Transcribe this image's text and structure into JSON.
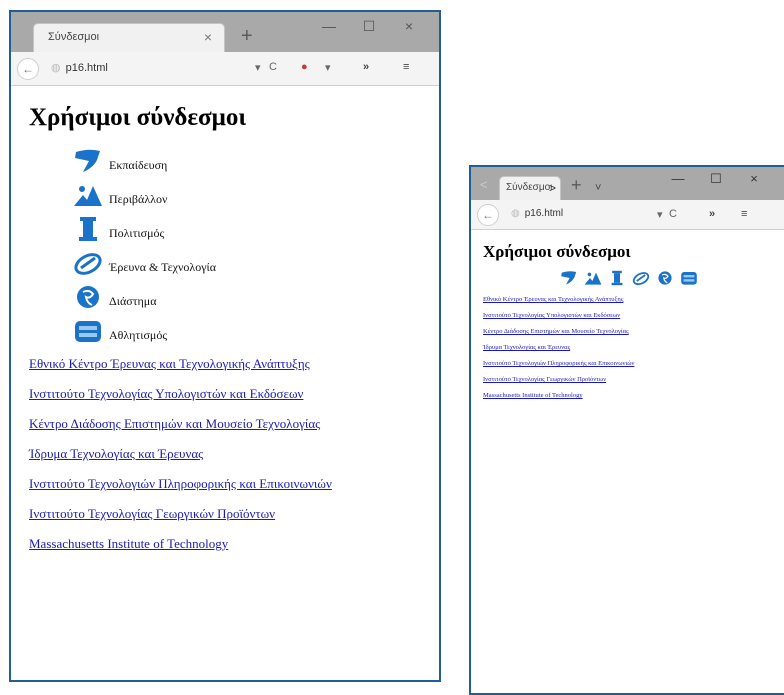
{
  "browser": {
    "tab_title": "Σύνδεσμοι",
    "url": "p16.html",
    "tab_close": "×",
    "new_tab": "+",
    "tab_list_arrow": ">",
    "tab_list_more": "˅",
    "back": "←",
    "reload": "C",
    "dropdown": "▾",
    "overflow": "»",
    "menu": "≡",
    "back_faint": "<",
    "win_min": "—",
    "win_max": "☐",
    "win_close": "×"
  },
  "page": {
    "heading": "Χρήσιμοι σύνδεσμοι",
    "categories": [
      {
        "label": "Εκπαίδευση",
        "icon": "education-icon"
      },
      {
        "label": "Περιβάλλον",
        "icon": "environment-icon"
      },
      {
        "label": "Πολιτισμός",
        "icon": "culture-icon"
      },
      {
        "label": "Έρευνα & Τεχνολογία",
        "icon": "research-icon"
      },
      {
        "label": "Διάστημα",
        "icon": "space-icon"
      },
      {
        "label": "Αθλητισμός",
        "icon": "sports-icon"
      }
    ],
    "links": [
      "Εθνικό Κέντρο Έρευνας και Τεχνολογικής Ανάπτυξης",
      "Ινστιτούτο Τεχνολογίας Υπολογιστών και Εκδόσεων",
      "Κέντρο Διάδοσης Επιστημών και Μουσείο Τεχνολογίας",
      "Ίδρυμα Τεχνολογίας και Έρευνας",
      "Ινστιτούτο Τεχνολογιών Πληροφορικής και Επικοινωνιών",
      "Ινστιτούτο Τεχνολογίας Γεωργικών Προϊόντων",
      "Massachusetts Institute of Technology"
    ]
  },
  "colors": {
    "link": "#1a1ab8",
    "icon_blue": "#1a73c9",
    "window_border": "#1f5f95"
  }
}
